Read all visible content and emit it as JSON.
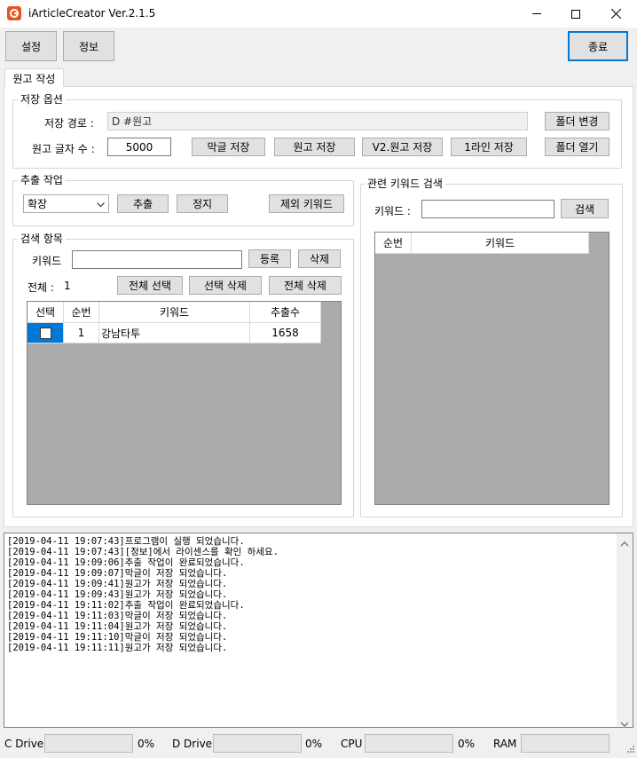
{
  "window": {
    "title": "iArticleCreator Ver.2.1.5",
    "minimize": "—",
    "maximize": "☐",
    "close": "✕"
  },
  "toolbar": {
    "settings": "설정",
    "info": "정보",
    "exit": "종료"
  },
  "tab": "원고 작성",
  "save_options": {
    "title": "저장 옵션",
    "path_label": "저장 경로 :",
    "path_value": "D                                                                         #원고",
    "change_folder": "폴더 변경",
    "char_count_label": "원고 글자 수 :",
    "char_count_value": "5000",
    "save_makgeul": "막글 저장",
    "save_wongo": "원고 저장",
    "save_v2": "V2.원고 저장",
    "save_1line": "1라인 저장",
    "open_folder": "폴더 열기"
  },
  "extract": {
    "title": "추출 작업",
    "mode_value": "확장",
    "extract_btn": "추출",
    "stop_btn": "정지",
    "exclude_btn": "제외 키워드"
  },
  "search_items": {
    "title": "검색 항목",
    "keyword_label": "키워드",
    "keyword_value": "",
    "register_btn": "등록",
    "delete_btn": "삭제",
    "total_label": "전체 :",
    "total_count": "1",
    "select_all_btn": "전체 선택",
    "delete_selected_btn": "선택 삭제",
    "delete_all_btn": "전체 삭제",
    "columns": [
      "선택",
      "순번",
      "키워드",
      "추출수"
    ],
    "rows": [
      {
        "checked": false,
        "no": "1",
        "keyword": "강남타투",
        "count": "1658"
      }
    ]
  },
  "related": {
    "title": "관련 키워드 검색",
    "keyword_label": "키워드 :",
    "keyword_value": "",
    "search_btn": "검색",
    "columns": [
      "순번",
      "키워드"
    ]
  },
  "log": [
    "[2019-04-11 19:07:43]프로그램이 실행 되었습니다.",
    "[2019-04-11 19:07:43][정보]에서 라이센스를 확인 하세요.",
    "[2019-04-11 19:09:06]추출 작업이 완료되었습니다.",
    "[2019-04-11 19:09:07]막글이 저장 되었습니다.",
    "[2019-04-11 19:09:41]원고가 저장 되었습니다.",
    "[2019-04-11 19:09:43]원고가 저장 되었습니다.",
    "[2019-04-11 19:11:02]추출 작업이 완료되었습니다.",
    "[2019-04-11 19:11:03]막글이 저장 되었습니다.",
    "[2019-04-11 19:11:04]원고가 저장 되었습니다.",
    "[2019-04-11 19:11:10]막글이 저장 되었습니다.",
    "[2019-04-11 19:11:11]원고가 저장 되었습니다."
  ],
  "status": {
    "c_drive_label": "C Drive",
    "c_drive_value": "0%",
    "c_drive_fraction": 0,
    "d_drive_label": "D Drive",
    "d_drive_value": "0%",
    "d_drive_fraction": 0,
    "cpu_label": "CPU",
    "cpu_value": "0%",
    "cpu_fraction": 0,
    "ram_label": "RAM",
    "ram_fraction": 0
  },
  "icons": {
    "app_icon": "app-logo-icon",
    "dropdown": "chevron-down-icon"
  },
  "colors": {
    "accent": "#0078d7",
    "app_icon": "#e8541b",
    "selected_cell": "#0078d7"
  }
}
